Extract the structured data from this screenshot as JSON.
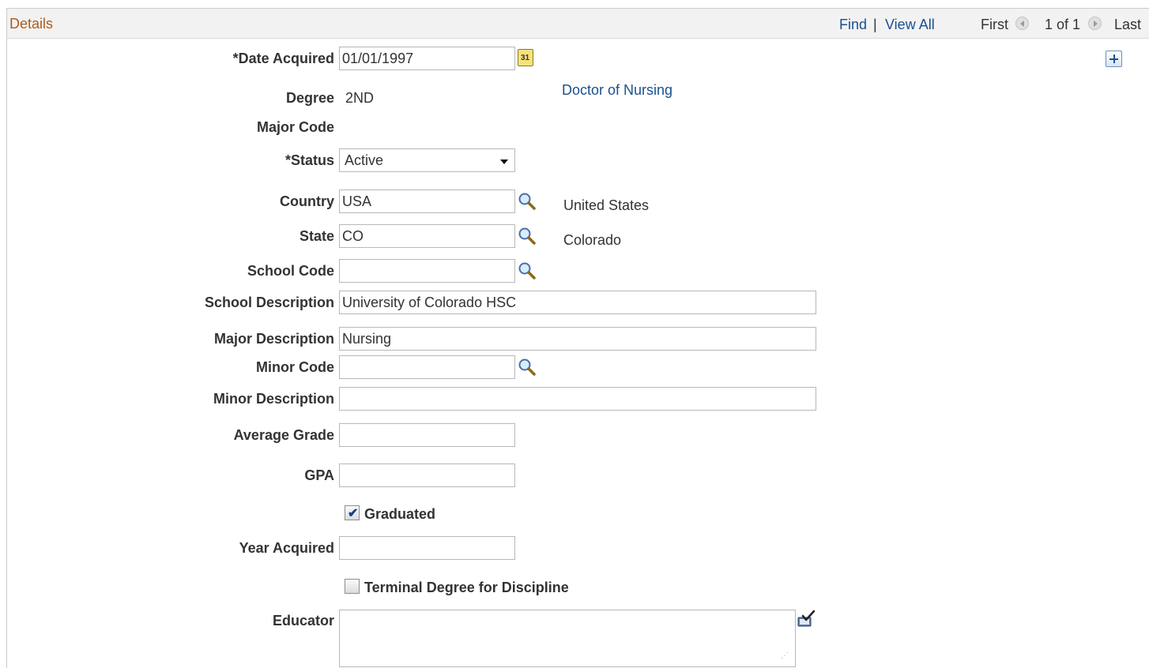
{
  "header": {
    "title": "Details",
    "find": "Find",
    "separator": "|",
    "view_all": "View All",
    "first": "First",
    "paging": "1 of 1",
    "last": "Last"
  },
  "fields": {
    "date_acquired": {
      "label": "*Date Acquired",
      "value": "01/01/1997"
    },
    "degree": {
      "label": "Degree",
      "value": "2ND",
      "description": "Doctor of Nursing"
    },
    "major_code": {
      "label": "Major Code"
    },
    "status": {
      "label": "*Status",
      "value": "Active"
    },
    "country": {
      "label": "Country",
      "value": "USA",
      "description": "United States"
    },
    "state": {
      "label": "State",
      "value": "CO",
      "description": "Colorado"
    },
    "school_code": {
      "label": "School Code",
      "value": ""
    },
    "school_description": {
      "label": "School Description",
      "value": "University of Colorado HSC"
    },
    "major_description": {
      "label": "Major Description",
      "value": "Nursing"
    },
    "minor_code": {
      "label": "Minor Code",
      "value": ""
    },
    "minor_description": {
      "label": "Minor Description",
      "value": ""
    },
    "average_grade": {
      "label": "Average Grade",
      "value": ""
    },
    "gpa": {
      "label": "GPA",
      "value": ""
    },
    "graduated": {
      "label": "Graduated",
      "checked": true
    },
    "year_acquired": {
      "label": "Year Acquired",
      "value": ""
    },
    "terminal_degree": {
      "label": "Terminal Degree for Discipline",
      "checked": false
    },
    "educator": {
      "label": "Educator",
      "value": ""
    }
  },
  "icons": {
    "calendar": "calendar-icon",
    "lookup": "magnifier-icon",
    "add_row": "plus-icon",
    "spellcheck": "spellcheck-icon",
    "calendar_text": "31"
  },
  "colors": {
    "link": "#19518f",
    "header_title": "#b05a1a",
    "header_bg": "#f2f2f2"
  }
}
